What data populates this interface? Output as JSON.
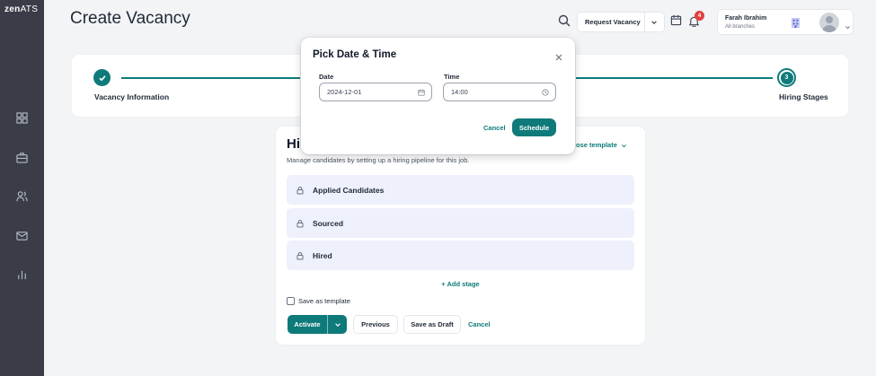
{
  "sidebar": {
    "logo_main": "zen",
    "logo_suffix": "ATS",
    "items": [
      {
        "icon": "dashboard-grid-icon"
      },
      {
        "icon": "briefcase-icon"
      },
      {
        "icon": "users-icon"
      },
      {
        "icon": "mail-icon"
      },
      {
        "icon": "bar-chart-icon"
      }
    ]
  },
  "header": {
    "title": "Create Vacancy",
    "request_vacancy_label": "Request Vacancy",
    "notification_count": "4",
    "user": {
      "name": "Farah Ibrahim",
      "branch": "All branches"
    }
  },
  "stepper": {
    "steps": [
      {
        "label": "Vacancy Information",
        "state": "completed"
      },
      {
        "label": "Hiring Stages",
        "number": "3",
        "state": "current"
      }
    ]
  },
  "main": {
    "title": "Hi",
    "choose_template_label": "oose template",
    "description": "Manage candidates by setting up a hiring pipeline for this job.",
    "stages": [
      {
        "name": "Applied Candidates"
      },
      {
        "name": "Sourced"
      },
      {
        "name": "Hired"
      }
    ],
    "add_stage_label": "+ Add stage",
    "save_as_template_label": "Save as template",
    "actions": {
      "activate": "Activate",
      "previous": "Previous",
      "save_draft": "Save as Draft",
      "cancel": "Cancel"
    }
  },
  "modal": {
    "title": "Pick Date & Time",
    "date_label": "Date",
    "date_value": "2024-12-01",
    "time_label": "Time",
    "time_value": "14:00",
    "cancel_label": "Cancel",
    "schedule_label": "Schedule"
  },
  "colors": {
    "accent": "#0f7a7a",
    "sidebar_bg": "#3a3d48",
    "badge": "#e53e3e",
    "stage_bg": "#eef0fb"
  }
}
